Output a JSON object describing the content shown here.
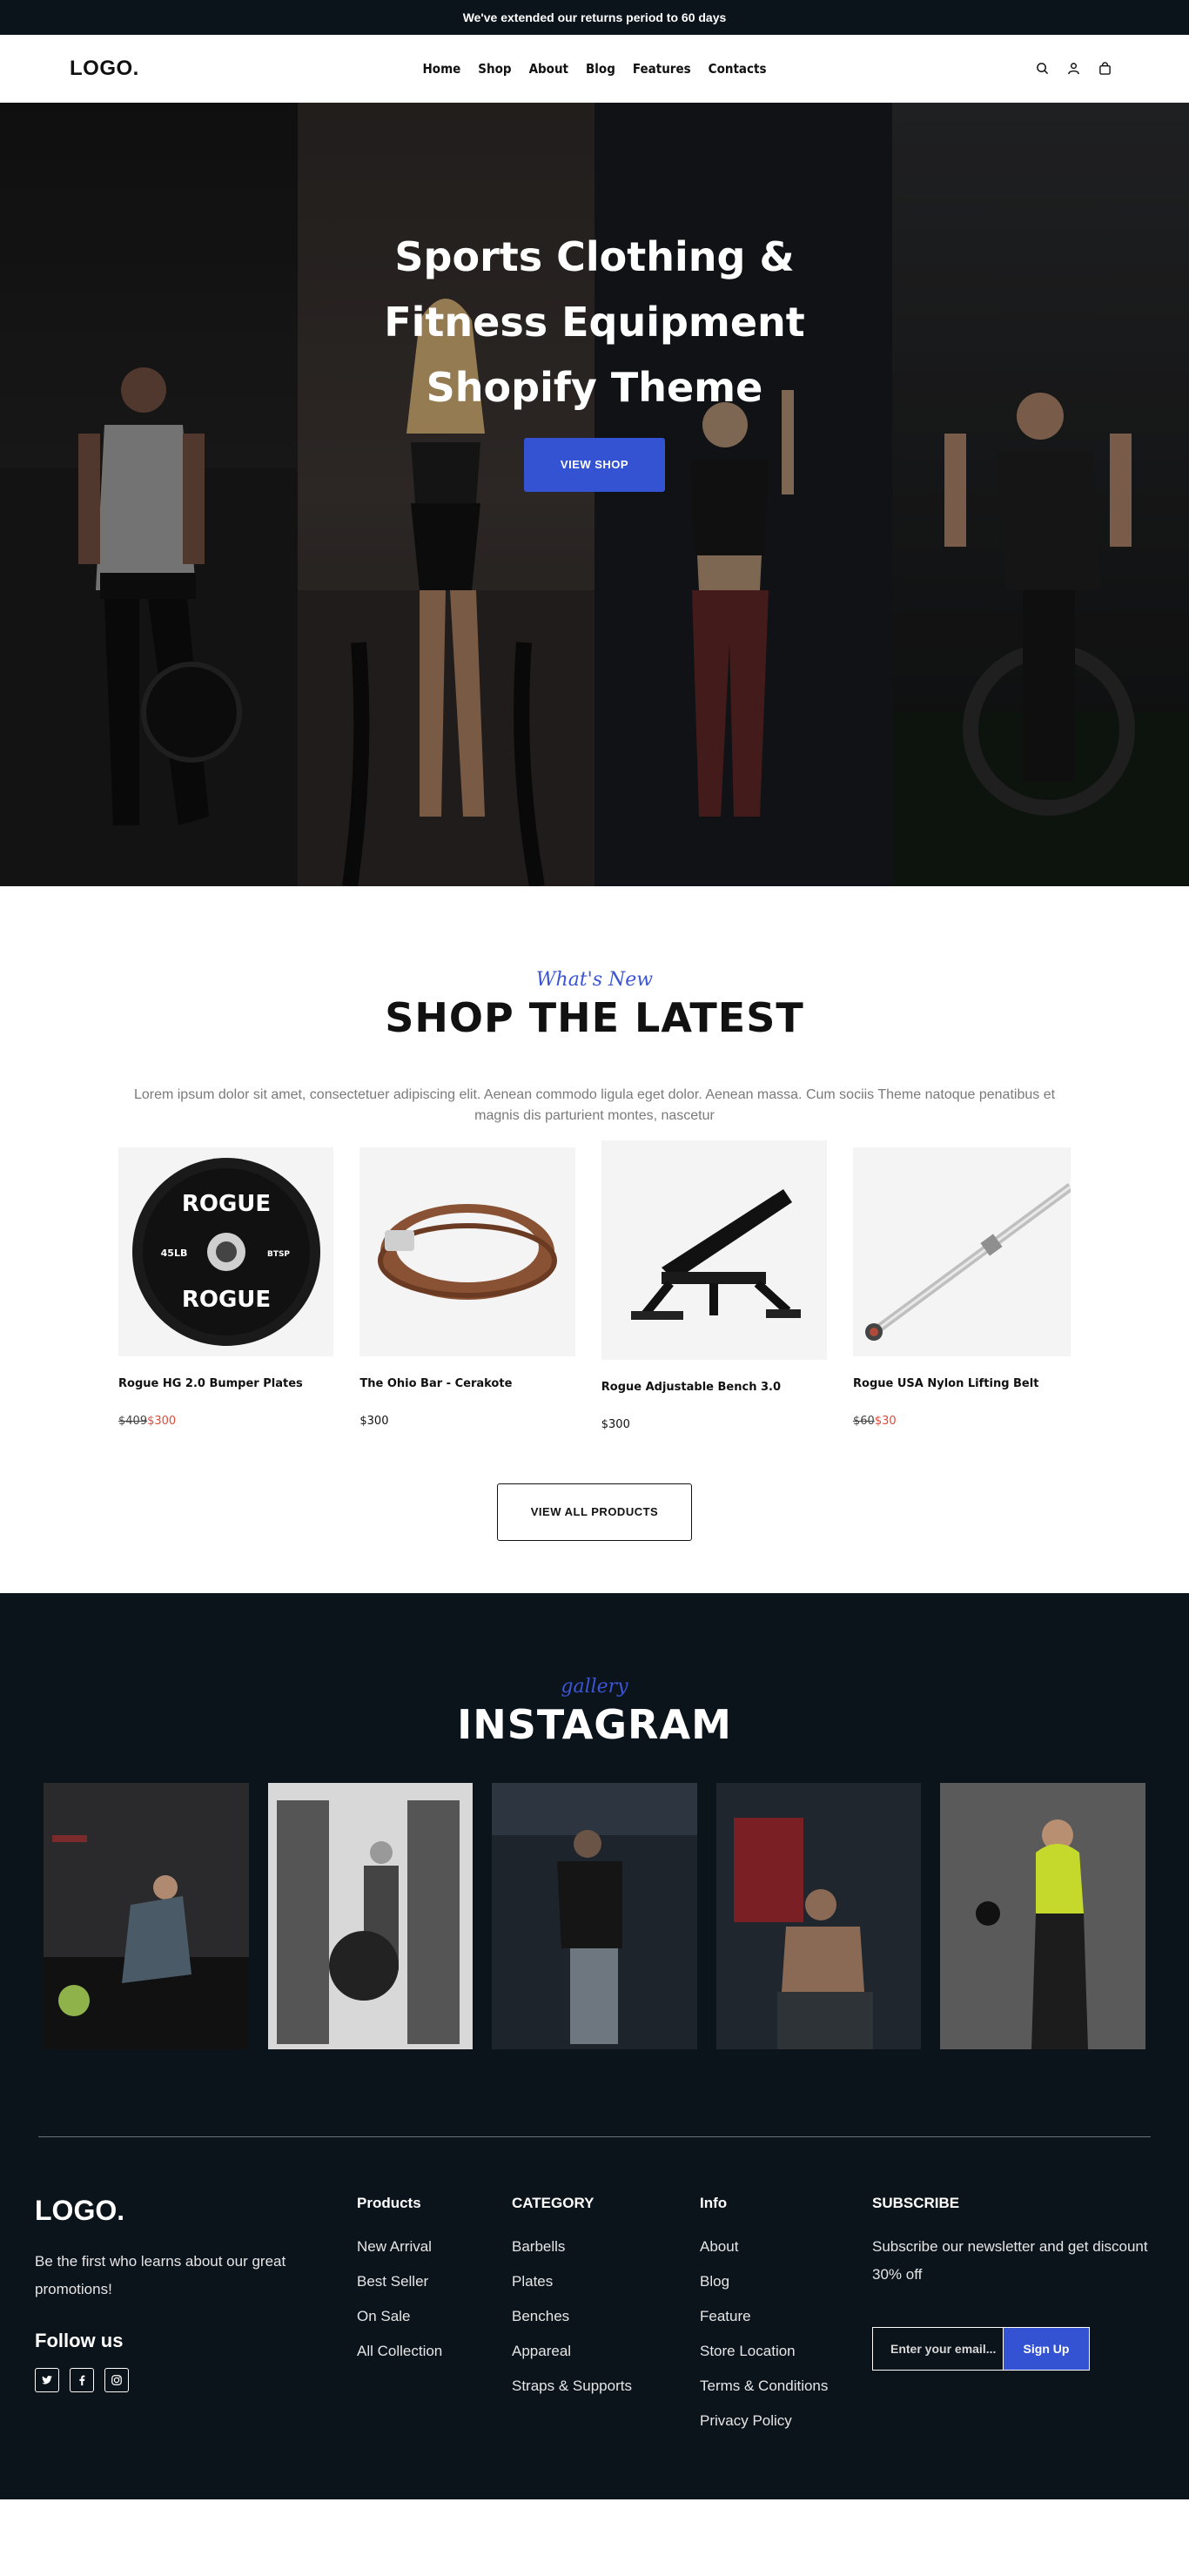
{
  "announcement": "We've extended our returns period to 60 days",
  "header": {
    "logo": "LOGO.",
    "nav": [
      "Home",
      "Shop",
      "About",
      "Blog",
      "Features",
      "Contacts"
    ],
    "icons": [
      "search-icon",
      "user-icon",
      "cart-icon"
    ]
  },
  "hero": {
    "title": "Sports Clothing &\nFitness Equipment\nShopify Theme",
    "button": "VIEW SHOP"
  },
  "latest": {
    "script": "What's New",
    "title": "SHOP THE LATEST",
    "description": "Lorem ipsum dolor sit amet, consectetuer adipiscing elit. Aenean commodo ligula eget dolor. Aenean massa. Cum sociis Theme natoque penatibus et magnis dis parturient montes, nascetur",
    "products": [
      {
        "name": "Rogue HG 2.0 Bumper Plates",
        "old_price": "$409",
        "price": "$300"
      },
      {
        "name": "The Ohio Bar - Cerakote",
        "old_price": "",
        "price": "$300"
      },
      {
        "name": "Rogue Adjustable Bench 3.0",
        "old_price": "",
        "price": "$300"
      },
      {
        "name": "Rogue USA Nylon Lifting Belt",
        "old_price": "$60",
        "price": "$30"
      }
    ],
    "plate_text": {
      "brand": "ROGUE",
      "left": "45LB",
      "right": "BTSP"
    },
    "view_all": "VIEW ALL PRODUCTS"
  },
  "instagram": {
    "script": "gallery",
    "title": "INSTAGRAM"
  },
  "footer": {
    "logo": "LOGO.",
    "tagline": "Be the first who learns about our great promotions!",
    "follow": "Follow us",
    "socials": [
      "twitter-icon",
      "facebook-icon",
      "instagram-icon"
    ],
    "products_title": "Products",
    "products": [
      "New Arrival",
      "Best Seller",
      "On Sale",
      "All Collection"
    ],
    "category_title": "CATEGORY",
    "category": [
      "Barbells",
      "Plates",
      "Benches",
      "Appareal",
      "Straps & Supports"
    ],
    "info_title": "Info",
    "info": [
      "About",
      "Blog",
      "Feature",
      "Store Location",
      "Terms & Conditions",
      "Privacy Policy"
    ],
    "subscribe_title": "SUBSCRIBE",
    "subscribe_text": "Subscribe our newsletter and get discount 30% off",
    "email_placeholder": "Enter your email...",
    "signup": "Sign Up"
  },
  "colors": {
    "accent": "#3353d3",
    "dark": "#0b131b",
    "sale": "#e04a3a"
  }
}
